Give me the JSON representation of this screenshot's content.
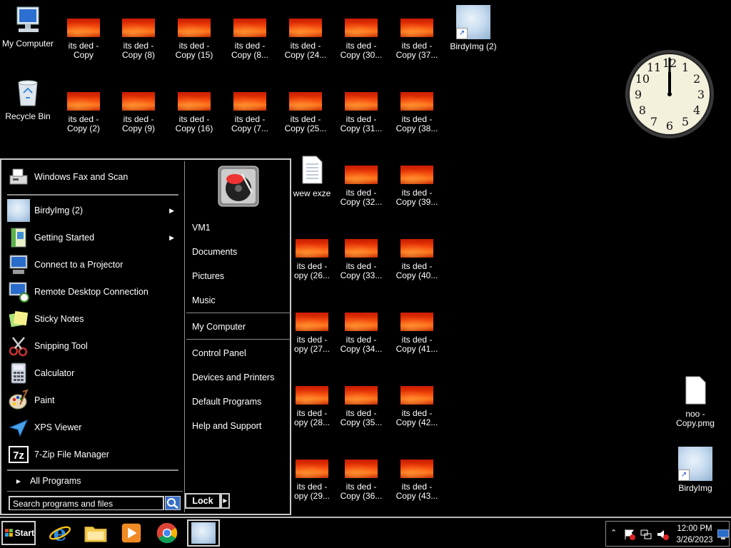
{
  "desktop": {
    "my_computer": "My Computer",
    "recycle_bin": "Recycle Bin",
    "birdy2": "BirdyImg (2)",
    "birdy": "BirdyImg",
    "noo": "noo -\nCopy.pmg",
    "wew": "wew exze",
    "col1": [
      "its ded -\nCopy",
      "its ded -\nCopy (2)"
    ],
    "col2": [
      "its ded -\nCopy (8)",
      "its ded -\nCopy (9)"
    ],
    "col3": [
      "its ded -\nCopy (15)",
      "its ded -\nCopy (16)"
    ],
    "col4": [
      "its ded -\nCopy (8...",
      "its ded -\nCopy (7..."
    ],
    "col5": [
      "its ded -\nCopy (24...",
      "its ded -\nCopy (25...",
      "its ded -\nopy (26...",
      "its ded -\nopy (27...",
      "its ded -\nopy (28...",
      "its ded -\nopy (29..."
    ],
    "col6": [
      "its ded -\nCopy (30...",
      "its ded -\nCopy (31...",
      "its ded -\nCopy (32...",
      "its ded -\nCopy (33...",
      "its ded -\nCopy (34...",
      "its ded -\nCopy (35...",
      "its ded -\nCopy (36..."
    ],
    "col7": [
      "its ded -\nCopy (37...",
      "its ded -\nCopy (38...",
      "its ded -\nCopy (39...",
      "its ded -\nCopy (40...",
      "its ded -\nCopy (41...",
      "its ded -\nCopy (42...",
      "its ded -\nCopy (43..."
    ]
  },
  "clock": {
    "numbers": [
      "12",
      "1",
      "2",
      "3",
      "4",
      "5",
      "6",
      "7",
      "8",
      "9",
      "10",
      "11"
    ],
    "hour": 12,
    "minute": 0
  },
  "start_menu": {
    "pinned": "Windows Fax and Scan",
    "programs": [
      {
        "label": "BirdyImg (2)",
        "arrow": true
      },
      {
        "label": "Getting Started",
        "arrow": true
      },
      {
        "label": "Connect to a Projector"
      },
      {
        "label": "Remote Desktop Connection"
      },
      {
        "label": "Sticky Notes"
      },
      {
        "label": "Snipping Tool"
      },
      {
        "label": "Calculator"
      },
      {
        "label": "Paint"
      },
      {
        "label": "XPS Viewer"
      },
      {
        "label": "7-Zip File Manager"
      }
    ],
    "all_programs": "All Programs",
    "search_placeholder": "Search programs and files",
    "right": {
      "user": "VM1",
      "documents": "Documents",
      "pictures": "Pictures",
      "music": "Music",
      "my_computer": "My Computer",
      "control_panel": "Control Panel",
      "devices": "Devices and Printers",
      "default_programs": "Default Programs",
      "help": "Help and Support"
    },
    "lock": "Lock"
  },
  "taskbar": {
    "start": "Start",
    "time": "12:00 PM",
    "date": "3/26/2023"
  },
  "colors": {
    "accent": "#3a6fc8",
    "fire": "#f23c08",
    "border": "#c9c9c9"
  }
}
